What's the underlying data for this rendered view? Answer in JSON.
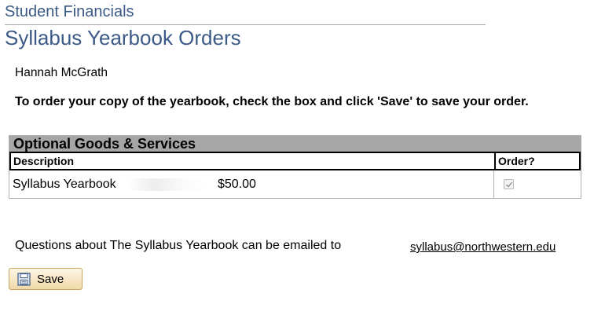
{
  "header": {
    "breadcrumb": "Student Financials",
    "title": "Syllabus Yearbook Orders"
  },
  "student": {
    "name": "Hannah McGrath"
  },
  "instructions": "To order your copy of the yearbook, check the box and click 'Save'  to save your order.",
  "goods_panel": {
    "title": "Optional Goods & Services",
    "columns": {
      "description": "Description",
      "order": "Order?"
    },
    "rows": [
      {
        "description": "Syllabus Yearbook",
        "price": "$50.00",
        "ordered": true
      }
    ]
  },
  "questions": {
    "text": "Questions about The Syllabus Yearbook can be emailed to",
    "email": "syllabus@northwestern.edu"
  },
  "actions": {
    "save_label": "Save",
    "save_icon": "save-disk-icon"
  },
  "colors": {
    "heading_blue": "#3c5a86",
    "panel_header_gray": "#a6a6a6",
    "button_border": "#c9a25c"
  }
}
